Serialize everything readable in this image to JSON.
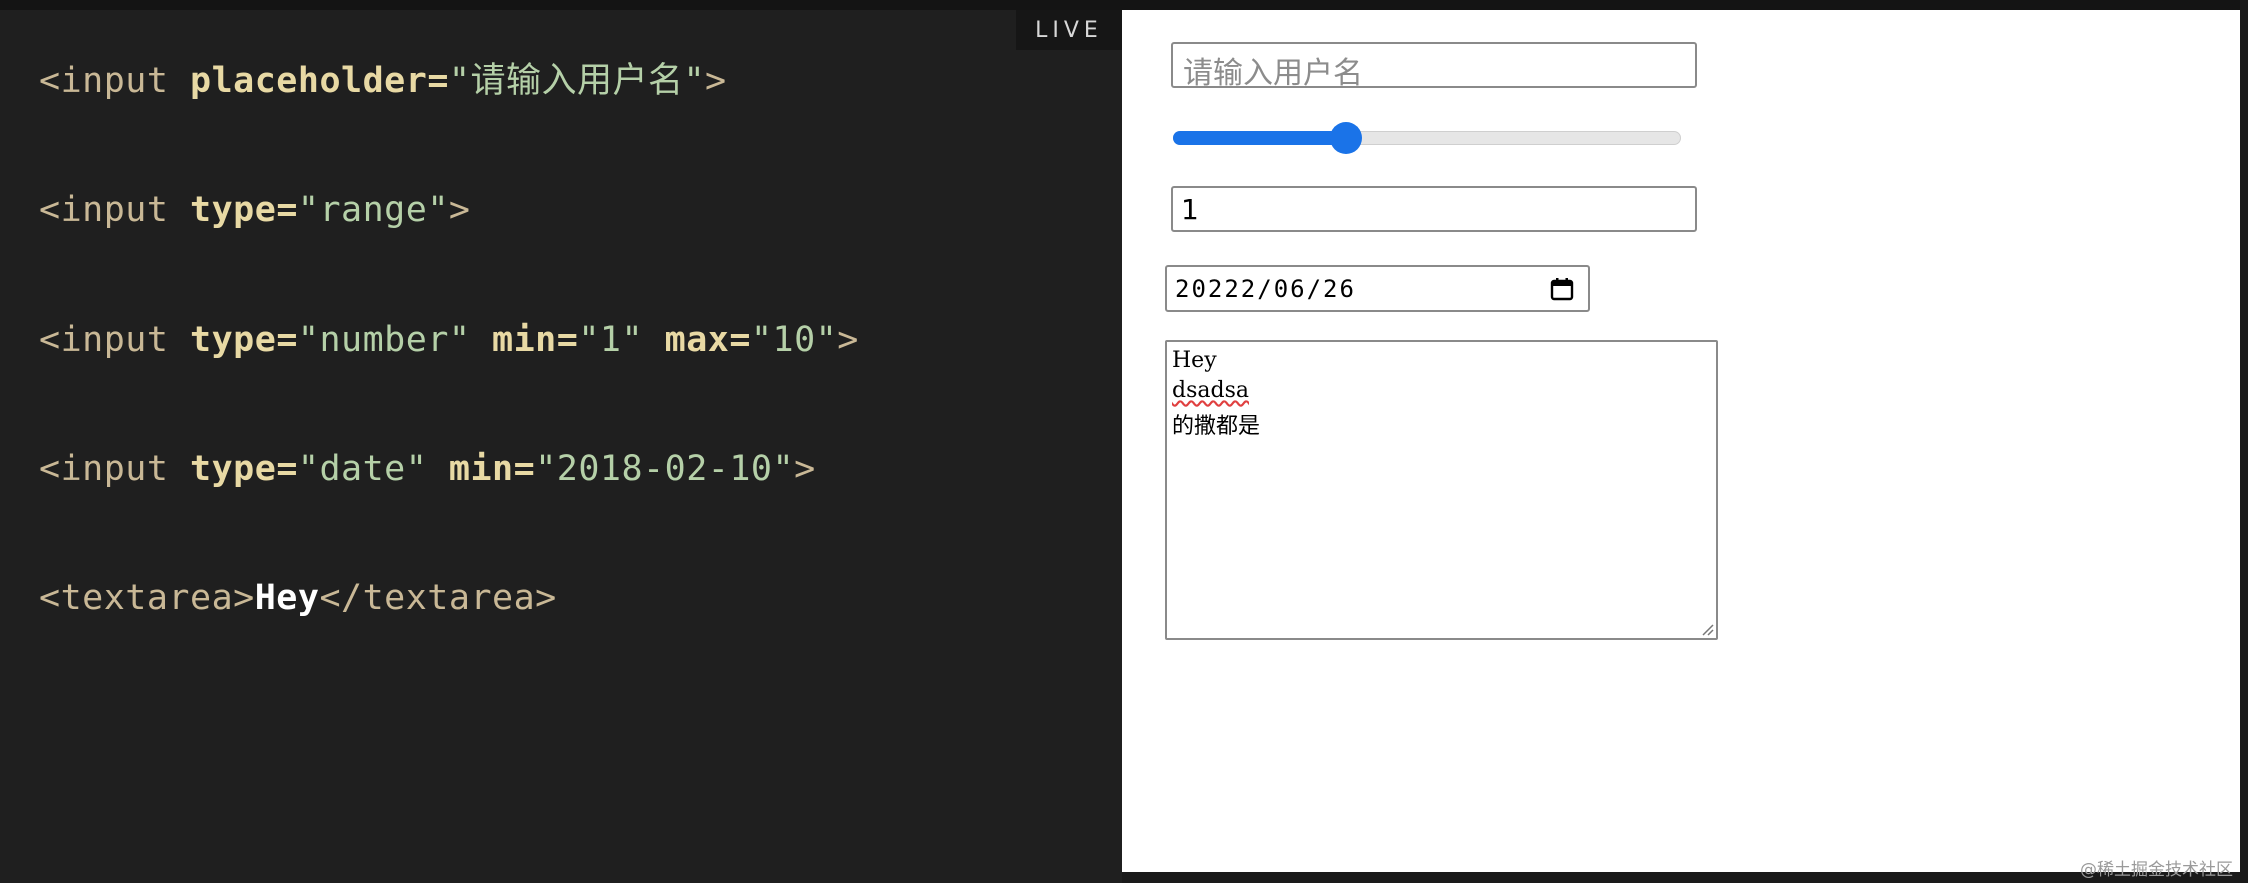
{
  "badge": {
    "live": "LIVE"
  },
  "code": {
    "line1": {
      "open": "<input ",
      "attr": "placeholder",
      "eq": "=",
      "val": "\"请输入用户名\"",
      "close": ">"
    },
    "line2": {
      "open": "<input ",
      "attr": "type",
      "eq": "=",
      "val": "\"range\"",
      "close": ">"
    },
    "line3": {
      "open": "<input ",
      "attr1": "type",
      "eq1": "=",
      "val1": "\"number\"",
      "attr2": " min",
      "eq2": "=",
      "val2": "\"1\"",
      "attr3": " max",
      "eq3": "=",
      "val3": "\"10\"",
      "close": ">"
    },
    "line4": {
      "open": "<input ",
      "attr1": "type",
      "eq1": "=",
      "val1": "\"date\"",
      "attr2": " min",
      "eq2": "=",
      "val2": "\"2018-02-10\"",
      "close": ">"
    },
    "line5": {
      "open": "<textarea>",
      "text": "Hey",
      "close": "</textarea>"
    }
  },
  "preview": {
    "text_input": {
      "placeholder": "请输入用户名"
    },
    "range": {
      "value_fraction": 0.33
    },
    "number": {
      "value": "1"
    },
    "date": {
      "value": "20222/06/26"
    },
    "textarea": {
      "lines": [
        "Hey",
        "dsadsa",
        "的撒都是"
      ]
    }
  },
  "watermark": "@稀土掘金技术社区",
  "colors": {
    "accent": "#1a73e8",
    "editor_bg": "#1f1f1f"
  }
}
